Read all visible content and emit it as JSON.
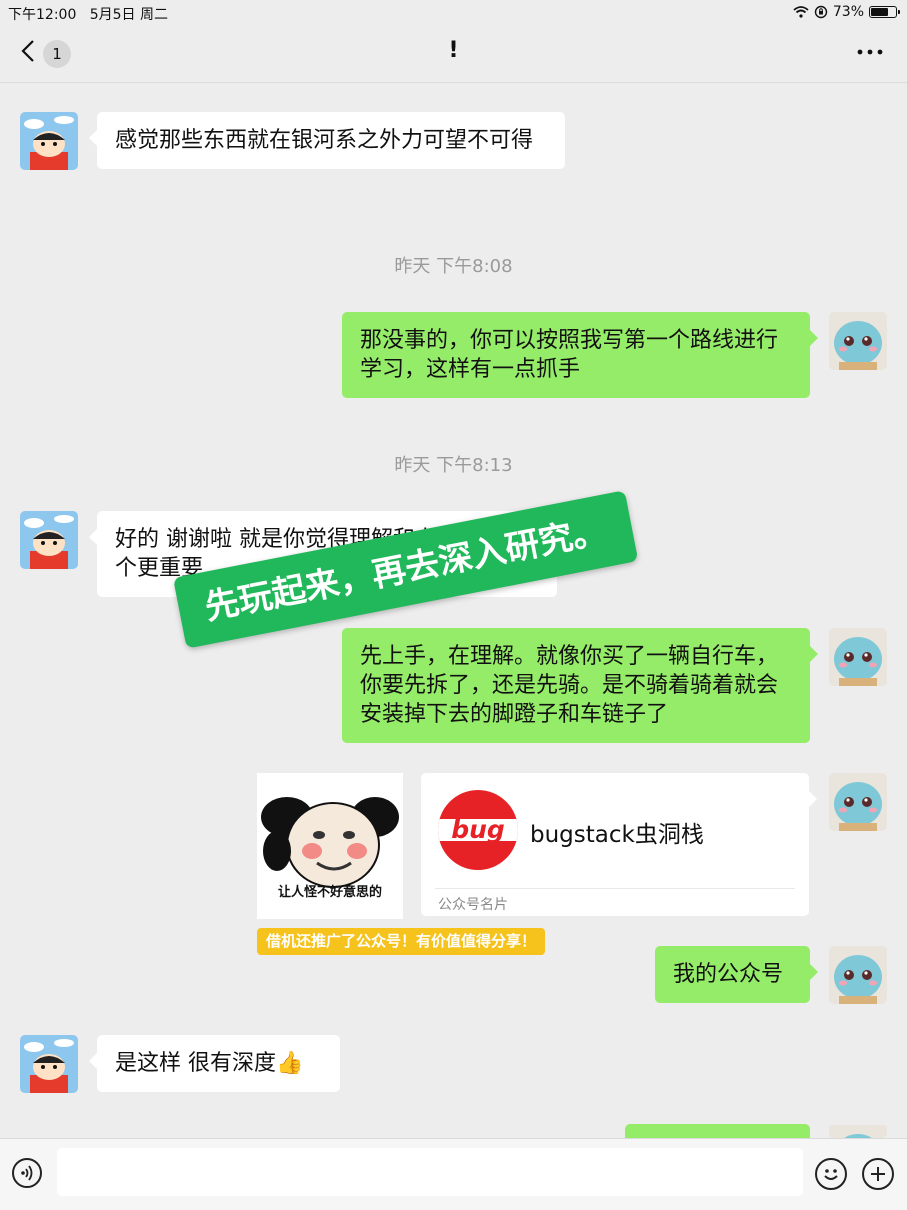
{
  "status_bar": {
    "time": "下午12:00",
    "date": "5月5日 周二",
    "battery_text": "73%",
    "battery_level": 0.73
  },
  "nav": {
    "back_icon": "chevron-left-icon",
    "unread_badge": "1",
    "title": "!",
    "more_icon": "more-dots-icon"
  },
  "messages": [
    {
      "side": "in",
      "text": "感觉那些东西就在银河系之外力可望不可得"
    },
    {
      "type": "time",
      "text": "昨天 下午8:08"
    },
    {
      "side": "out",
      "text": "那没事的，你可以按照我写第一个路线进行学习，这样有一点抓手"
    },
    {
      "type": "time",
      "text": "昨天 下午8:13"
    },
    {
      "side": "in",
      "text": "好的 谢谢啦  就是你觉得理解和上手实践那个更重要"
    },
    {
      "side": "out",
      "text": "先上手，在理解。就像你买了一辆自行车，你要先拆了，还是先骑。是不骑着骑着就会安装掉下去的脚蹬子和车链子了"
    },
    {
      "side": "out",
      "type": "sticker",
      "caption": "让人怪不好意思的"
    },
    {
      "side": "out",
      "type": "card",
      "logo_text": "bug",
      "name": "bugstack虫洞栈",
      "card_type": "公众号名片"
    },
    {
      "side": "out",
      "text": "我的公众号"
    },
    {
      "side": "in",
      "text": "是这样  很有深度👍"
    }
  ],
  "overlay": {
    "banner": "先玩起来，再去深入研究。",
    "tag": "借机还推广了公众号！有价值值得分享！"
  },
  "input_bar": {
    "voice_icon": "voice-icon",
    "emoji_icon": "emoji-icon",
    "plus_icon": "plus-icon",
    "value": ""
  },
  "colors": {
    "background": "#ededed",
    "bubble_out": "#95ec69",
    "bubble_in": "#ffffff",
    "banner": "#20b85a",
    "tag": "#f6c21c",
    "logo": "#e62227"
  }
}
